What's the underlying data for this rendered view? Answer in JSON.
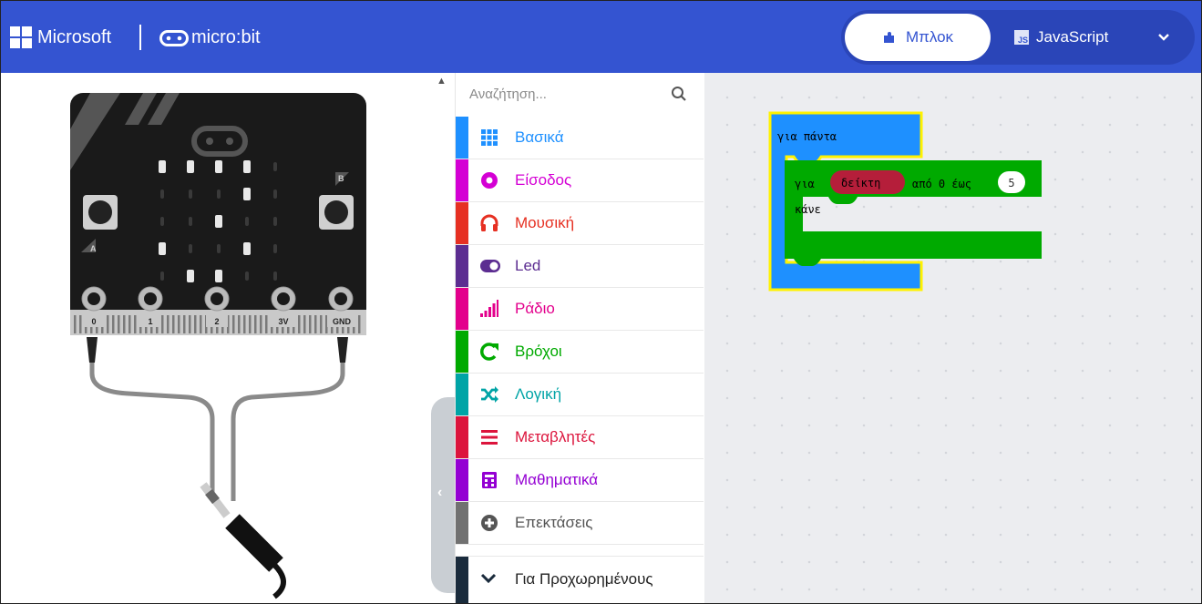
{
  "header": {
    "brand_microsoft": "Microsoft",
    "brand_microbit": "micro:bit",
    "tabs": {
      "blocks": "Μπλοκ",
      "javascript": "JavaScript"
    },
    "js_badge": "JS",
    "accent_color": "#3454D1"
  },
  "simulator": {
    "buttons": [
      "A",
      "B"
    ],
    "pins": [
      "0",
      "1",
      "2",
      "3V",
      "GND"
    ],
    "led_matrix": [
      [
        1,
        1,
        1,
        1,
        0
      ],
      [
        0,
        0,
        0,
        1,
        0
      ],
      [
        0,
        0,
        1,
        0,
        0
      ],
      [
        1,
        0,
        0,
        1,
        0
      ],
      [
        0,
        1,
        1,
        0,
        0
      ]
    ]
  },
  "toolbox": {
    "search_placeholder": "Αναζήτηση...",
    "categories": [
      {
        "label": "Βασικά",
        "color": "#1E90FF",
        "icon": "grid-icon"
      },
      {
        "label": "Είσοδος",
        "color": "#D400D4",
        "icon": "circle-icon"
      },
      {
        "label": "Μουσική",
        "color": "#E63022",
        "icon": "headphones-icon"
      },
      {
        "label": "Led",
        "color": "#5C2D91",
        "icon": "toggle-icon"
      },
      {
        "label": "Ράδιο",
        "color": "#E3008C",
        "icon": "signal-icon"
      },
      {
        "label": "Βρόχοι",
        "color": "#00AA00",
        "icon": "refresh-icon"
      },
      {
        "label": "Λογική",
        "color": "#00A4A6",
        "icon": "shuffle-icon"
      },
      {
        "label": "Μεταβλητές",
        "color": "#DC143C",
        "icon": "list-icon"
      },
      {
        "label": "Μαθηματικά",
        "color": "#9400D3",
        "icon": "calculator-icon"
      },
      {
        "label": "Επεκτάσεις",
        "color": "#717171",
        "icon": "plus-circle-icon"
      }
    ],
    "advanced_label": "Για Προχωρημένους"
  },
  "workspace": {
    "forever_label": "για πάντα",
    "for_label": "για",
    "variable_label": "δείκτη",
    "range_label": "από 0 έως",
    "end_value": "5",
    "do_label": "κάνε"
  }
}
